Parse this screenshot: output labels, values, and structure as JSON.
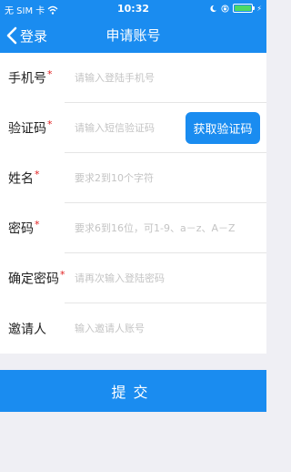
{
  "status_bar": {
    "carrier": "无 SIM 卡",
    "time": "10:32",
    "battery_color": "#4cd964"
  },
  "nav": {
    "back_label": "登录",
    "title": "申请账号"
  },
  "form": {
    "rows": [
      {
        "label": "手机号",
        "required_mark": "*",
        "placeholder": "请输入登陆手机号",
        "value": ""
      },
      {
        "label": "验证码",
        "required_mark": "*",
        "placeholder": "请输入短信验证码",
        "value": ""
      },
      {
        "label": "姓名",
        "required_mark": "*",
        "placeholder": "要求2到10个字符",
        "value": ""
      },
      {
        "label": "密码",
        "required_mark": "*",
        "placeholder": "要求6到16位，可1-9、a－z、A－Z",
        "value": ""
      },
      {
        "label": "确定密码",
        "required_mark": "*",
        "placeholder": "请再次输入登陆密码",
        "value": ""
      },
      {
        "label": "邀请人",
        "placeholder": "输入邀请人账号",
        "value": ""
      }
    ],
    "get_code_label": "获取验证码"
  },
  "submit_label": "提交",
  "colors": {
    "accent": "#1a8cf0",
    "required": "#e02020",
    "background": "#efeff4"
  },
  "icons": [
    "wifi-icon",
    "moon-icon",
    "lock-icon",
    "battery-icon",
    "charge-icon",
    "back-chevron-icon"
  ]
}
